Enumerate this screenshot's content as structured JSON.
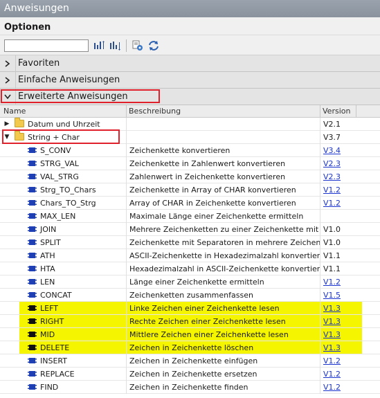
{
  "window": {
    "title": "Anweisungen"
  },
  "options": {
    "label": "Optionen",
    "search_value": ""
  },
  "sections": [
    {
      "label": "Favoriten",
      "expanded": false
    },
    {
      "label": "Einfache Anweisungen",
      "expanded": false
    },
    {
      "label": "Erweiterte Anweisungen",
      "expanded": true
    }
  ],
  "columns": {
    "name": "Name",
    "description": "Beschreibung",
    "version": "Version"
  },
  "folders": [
    {
      "name": "Datum und Uhrzeit",
      "version": "V2.1",
      "expanded": false
    },
    {
      "name": "String + Char",
      "version": "V3.7",
      "expanded": true
    }
  ],
  "instructions": [
    {
      "name": "S_CONV",
      "description": "Zeichenkette konvertieren",
      "version": "V3.4",
      "link": true,
      "highlight": false
    },
    {
      "name": "STRG_VAL",
      "description": "Zeichenkette in Zahlenwert konvertieren",
      "version": "V2.3",
      "link": true,
      "highlight": false
    },
    {
      "name": "VAL_STRG",
      "description": "Zahlenwert in Zeichenkette konvertieren",
      "version": "V2.3",
      "link": true,
      "highlight": false
    },
    {
      "name": "Strg_TO_Chars",
      "description": "Zeichenkette in Array of CHAR konvertieren",
      "version": "V1.2",
      "link": true,
      "highlight": false
    },
    {
      "name": "Chars_TO_Strg",
      "description": "Array of CHAR in Zeichenkette konvertieren",
      "version": "V1.2",
      "link": true,
      "highlight": false
    },
    {
      "name": "MAX_LEN",
      "description": "Maximale Länge einer Zeichenkette ermitteln",
      "version": "",
      "link": false,
      "highlight": false
    },
    {
      "name": "JOIN",
      "description": "Mehrere Zeichenketten zu einer Zeichenkette mit ...",
      "version": "V1.0",
      "link": false,
      "highlight": false
    },
    {
      "name": "SPLIT",
      "description": "Zeichenkette mit Separatoren in mehrere Zeichen...",
      "version": "V1.0",
      "link": false,
      "highlight": false
    },
    {
      "name": "ATH",
      "description": "ASCII-Zeichenkette in Hexadezimalzahl konvertiere...",
      "version": "V1.1",
      "link": false,
      "highlight": false
    },
    {
      "name": "HTA",
      "description": "Hexadezimalzahl in ASCII-Zeichenkette konvertiere...",
      "version": "V1.1",
      "link": false,
      "highlight": false
    },
    {
      "name": "LEN",
      "description": "Länge einer Zeichenkette ermitteln",
      "version": "V1.2",
      "link": true,
      "highlight": false
    },
    {
      "name": "CONCAT",
      "description": "Zeichenketten zusammenfassen",
      "version": "V1.5",
      "link": true,
      "highlight": false
    },
    {
      "name": "LEFT",
      "description": "Linke Zeichen einer Zeichenkette lesen",
      "version": "V1.3",
      "link": true,
      "highlight": true
    },
    {
      "name": "RIGHT",
      "description": "Rechte Zeichen einer Zeichenkette lesen",
      "version": "V1.3",
      "link": true,
      "highlight": true
    },
    {
      "name": "MID",
      "description": "Mittlere Zeichen einer Zeichenkette lesen",
      "version": "V1.3",
      "link": true,
      "highlight": true
    },
    {
      "name": "DELETE",
      "description": "Zeichen in Zeichenkette löschen",
      "version": "V1.3",
      "link": true,
      "highlight": true
    },
    {
      "name": "INSERT",
      "description": "Zeichen in Zeichenkette einfügen",
      "version": "V1.2",
      "link": true,
      "highlight": false
    },
    {
      "name": "REPLACE",
      "description": "Zeichen in Zeichenkette ersetzen",
      "version": "V1.2",
      "link": true,
      "highlight": false
    },
    {
      "name": "FIND",
      "description": "Zeichen in Zeichenkette finden",
      "version": "V1.2",
      "link": true,
      "highlight": false
    }
  ],
  "colors": {
    "highlight": "#f5f500",
    "annotation_border": "#e0202a",
    "link": "#1a33cc"
  }
}
